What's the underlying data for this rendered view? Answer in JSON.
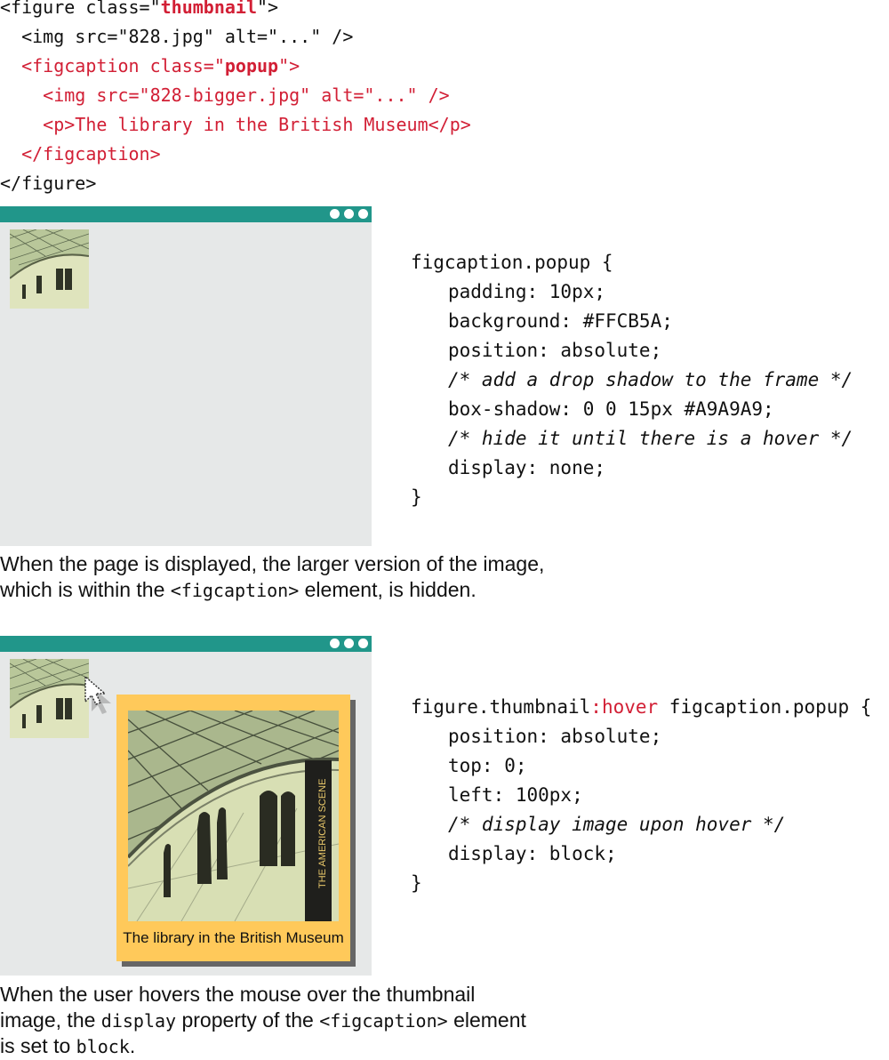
{
  "html_code": {
    "l1_a": "<figure class=\"",
    "l1_b": "thumbnail",
    "l1_c": "\">",
    "l2": "  <img src=\"828.jpg\" alt=\"...\" />",
    "l3_a": "  <figcaption class=\"",
    "l3_b": "popup",
    "l3_c": "\">",
    "l4": "    <img src=\"828-bigger.jpg\" alt=\"...\" />",
    "l5": "    <p>The library in the British Museum</p>",
    "l6": "  </figcaption>",
    "l7": "</figure>"
  },
  "css_block_1": {
    "selector": "figcaption.popup {",
    "padding": "padding: 10px;",
    "background": "background: #FFCB5A;",
    "position": "position: absolute;",
    "comment_shadow": "/* add a drop shadow to the frame */",
    "box_shadow": "box-shadow: 0 0 15px #A9A9A9;",
    "comment_hide": "/* hide it until there is a hover */",
    "display": "display: none;",
    "close": "}"
  },
  "caption_1": {
    "line1": "When the page is displayed, the larger version of the image,",
    "line2_a": "which is within the ",
    "line2_code": "<figcaption>",
    "line2_b": " element, is hidden."
  },
  "css_block_2": {
    "selector_a": "figure.thumbnail",
    "selector_hover": ":hover",
    "selector_b": " figcaption.popup {",
    "position": "position: absolute;",
    "top": "top: 0;",
    "left": "left: 100px;",
    "comment": "/* display image upon hover */",
    "display": "display: block;",
    "close": "}"
  },
  "popup": {
    "caption": "The library in the British Museum",
    "sign_text": "THE AMERICAN SCENE"
  },
  "caption_2": {
    "line1": "When the user hovers the mouse over the thumbnail",
    "line2_a": "image, the ",
    "line2_code": "display",
    "line2_b": " property of the ",
    "line2_code2": "<figcaption>",
    "line2_c": " element",
    "line3_a": "is set to ",
    "line3_code": "block",
    "line3_b": "."
  },
  "colors": {
    "browser_bar": "#21968a",
    "browser_bg": "#e6e8e8",
    "popup_bg": "#ffc95a",
    "code_red": "#d21f35",
    "comment_blue": "#1a86b5"
  },
  "icons": [
    "window-dots-icon",
    "mouse-pointer-icon"
  ]
}
